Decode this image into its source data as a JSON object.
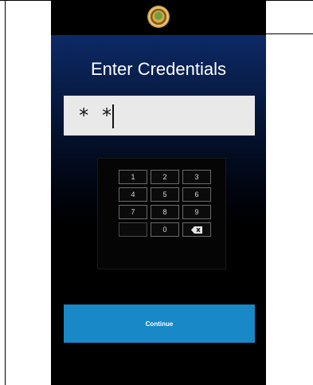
{
  "header": {
    "logo": "county-seal-icon"
  },
  "main": {
    "title": "Enter Credentials",
    "credential_value": "* *"
  },
  "keypad": {
    "keys": [
      "1",
      "2",
      "3",
      "4",
      "5",
      "6",
      "7",
      "8",
      "9",
      "",
      "0",
      "backspace-icon"
    ]
  },
  "actions": {
    "continue_label": "Continue"
  },
  "colors": {
    "header_blue": "#0d2a66",
    "input_bg": "#e9e9e9",
    "button": "#1888c7"
  }
}
